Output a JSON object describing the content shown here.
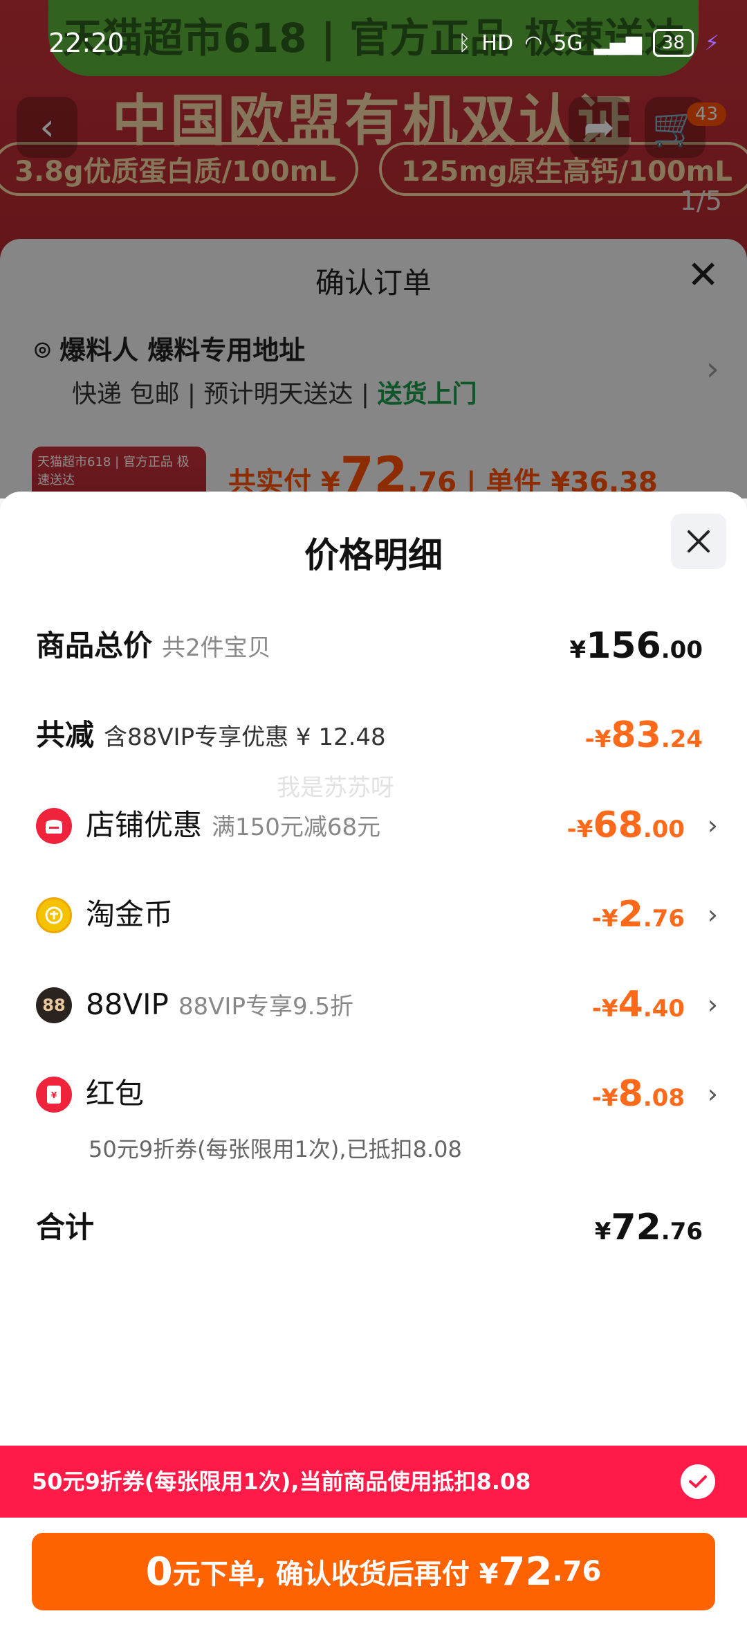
{
  "status_bar": {
    "time": "22:20",
    "battery": "38",
    "network": "5G",
    "hd": "HD"
  },
  "background": {
    "banner": "天猫超市618 | 官方正品 极速送达",
    "headline": "中国欧盟有机双认证",
    "pill_left": "3.8g优质蛋白质/100mL",
    "pill_right": "125mg原生高钙/100mL",
    "image_counter": "1/5",
    "cart_badge": "43"
  },
  "order_sheet": {
    "title": "确认订单",
    "address": "爆料人 爆料专用地址",
    "delivery_parts": [
      "快递 包邮",
      "预计明天送达"
    ],
    "delivery_highlight": "送货上门",
    "thumb_text": "天猫超市618 | 官方正品 极速送达",
    "paid_label": "共实付",
    "paid_currency": "¥",
    "paid_int": "72",
    "paid_dec": ".76",
    "unit_label": "单件",
    "unit_price": "¥36.38"
  },
  "price_detail": {
    "title": "价格明细",
    "watermark": "我是苏苏呀",
    "total": {
      "label": "商品总价",
      "sub": "共2件宝贝",
      "currency": "¥",
      "int": "156",
      "dec": ".00"
    },
    "discount_total": {
      "label": "共减",
      "sub": "含88VIP专享优惠 ¥ 12.48",
      "currency": "-¥",
      "int": "83",
      "dec": ".24"
    },
    "items": [
      {
        "label": "店铺优惠",
        "sub": "满150元减68元",
        "currency": "-¥",
        "int": "68",
        "dec": ".00",
        "icon": "store-icon",
        "icon_color": "#f0233c"
      },
      {
        "label": "淘金币",
        "sub": "",
        "currency": "-¥",
        "int": "2",
        "dec": ".76",
        "icon": "gold-coin-icon",
        "icon_color": "#f5c200"
      },
      {
        "label": "88VIP",
        "sub": "88VIP专享9.5折",
        "currency": "-¥",
        "int": "4",
        "dec": ".40",
        "icon": "vip-88-icon",
        "icon_color": "#2b2320",
        "icon_text": "88"
      },
      {
        "label": "红包",
        "sub": "",
        "currency": "-¥",
        "int": "8",
        "dec": ".08",
        "icon": "red-envelope-icon",
        "icon_color": "#f0233c",
        "note": "50元9折券(每张限用1次),已抵扣8.08"
      }
    ],
    "sum": {
      "label": "合计",
      "currency": "¥",
      "int": "72",
      "dec": ".76"
    }
  },
  "coupon_banner": {
    "text": "50元9折券(每张限用1次),当前商品使用抵扣8.08"
  },
  "pay_button": {
    "zero": "0",
    "text": "元下单, 确认收货后再付 ¥",
    "int": "72",
    "dec": ".76"
  },
  "colors": {
    "accent_orange": "#ff6200",
    "discount_orange": "#ff6a1a",
    "banner_red": "#ff1a48",
    "delivery_green": "#1a9b4a"
  }
}
